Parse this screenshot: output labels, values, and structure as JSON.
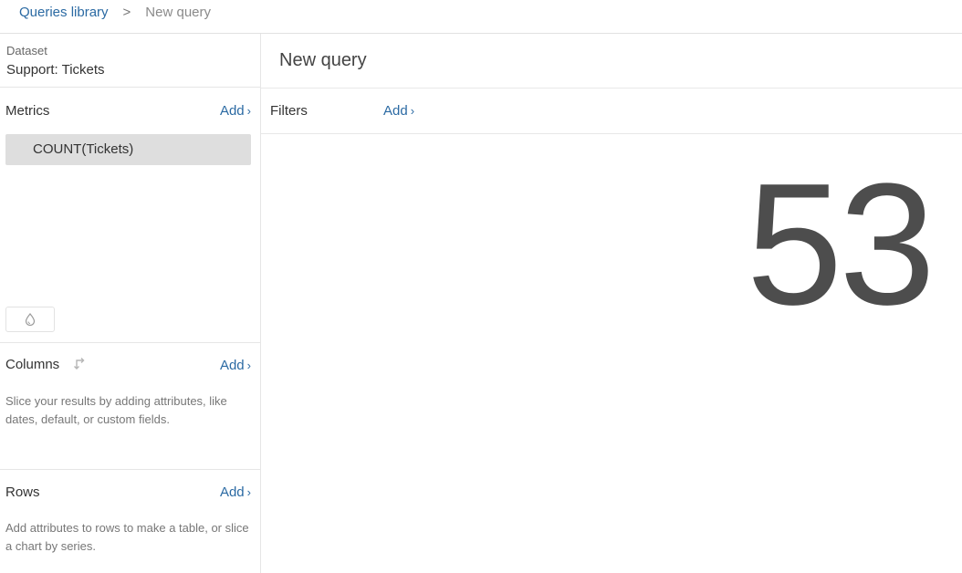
{
  "breadcrumb": {
    "parent": "Queries library",
    "separator": ">",
    "current": "New query"
  },
  "sidebar": {
    "dataset": {
      "label": "Dataset",
      "value": "Support: Tickets"
    },
    "metrics": {
      "title": "Metrics",
      "add_label": "Add",
      "items": [
        "COUNT(Tickets)"
      ]
    },
    "columns": {
      "title": "Columns",
      "add_label": "Add",
      "hint": "Slice your results by adding attributes, like dates, default, or custom fields."
    },
    "rows": {
      "title": "Rows",
      "add_label": "Add",
      "hint": "Add attributes to rows to make a table, or slice a chart by series."
    }
  },
  "main": {
    "title": "New query",
    "filters": {
      "label": "Filters",
      "add_label": "Add"
    },
    "result_value": "53"
  },
  "icons": {
    "chevron": "chevron-right-icon",
    "drop": "color-drop-icon",
    "swap": "swap-arrows-icon"
  },
  "colors": {
    "link": "#2b6aa3",
    "selected_metric_bg": "#dedede",
    "result_text": "#4d4d4d"
  }
}
